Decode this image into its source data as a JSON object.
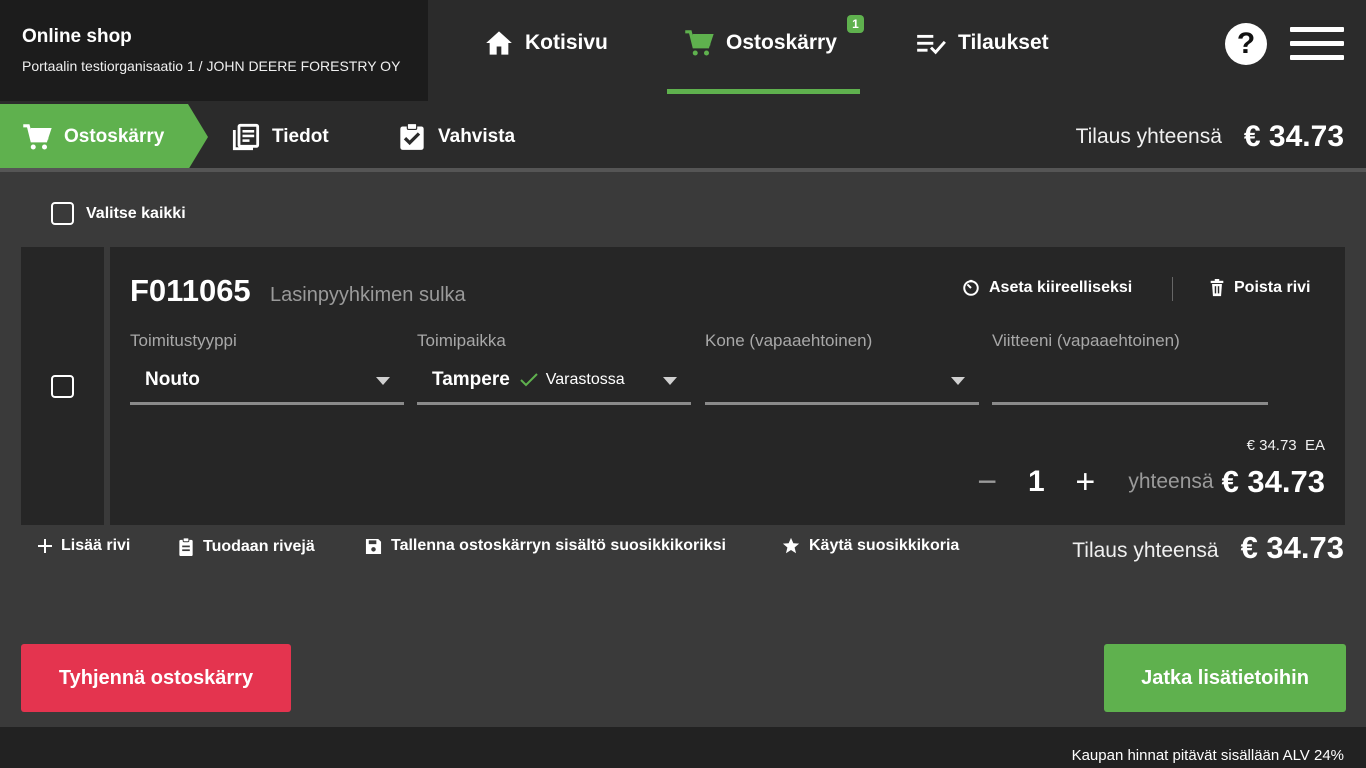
{
  "header": {
    "shop_title": "Online shop",
    "org_name": "Portaalin testiorganisaatio 1 / JOHN DEERE FORESTRY OY",
    "nav": [
      {
        "label": "Kotisivu",
        "icon": "home-icon"
      },
      {
        "label": "Ostoskärry",
        "icon": "cart-icon",
        "badge": "1",
        "active": true
      },
      {
        "label": "Tilaukset",
        "icon": "orders-icon"
      }
    ],
    "help_label": "?"
  },
  "steps": {
    "items": [
      {
        "label": "Ostoskärry",
        "icon": "cart-icon",
        "active": true
      },
      {
        "label": "Tiedot",
        "icon": "document-icon"
      },
      {
        "label": "Vahvista",
        "icon": "clipboard-check-icon"
      }
    ],
    "total_label": "Tilaus yhteensä",
    "total_value": "€ 34.73"
  },
  "select_all_label": "Valitse kaikki",
  "row": {
    "code": "F011065",
    "name": "Lasinpyyhkimen sulka",
    "urgent_label": "Aseta kiireelliseksi",
    "remove_label": "Poista rivi",
    "fields": {
      "delivery": {
        "label": "Toimitustyyppi",
        "value": "Nouto"
      },
      "location": {
        "label": "Toimipaikka",
        "value": "Tampere",
        "stock": "Varastossa"
      },
      "machine": {
        "label": "Kone (vapaaehtoinen)",
        "value": ""
      },
      "reference": {
        "label": "Viitteeni (vapaaehtoinen)",
        "value": ""
      }
    },
    "unit_price": "€ 34.73",
    "unit": "EA",
    "quantity": "1",
    "minus": "−",
    "plus": "+",
    "total_label": "yhteensä",
    "total_value": "€ 34.73"
  },
  "actions": {
    "add_row": "Lisää rivi",
    "import_rows": "Tuodaan rivejä",
    "save_favorite": "Tallenna ostoskärryn sisältö suosikkikoriksi",
    "use_favorite": "Käytä suosikkikoria"
  },
  "summary": {
    "total_label": "Tilaus yhteensä",
    "total_value": "€ 34.73"
  },
  "buttons": {
    "clear": "Tyhjennä ostoskärry",
    "continue": "Jatka lisätietoihin"
  },
  "footer": {
    "vat_note": "Kaupan hinnat pitävät sisällään ALV 24%"
  },
  "colors": {
    "accent": "#5fb14e",
    "danger": "#e4344f",
    "background": "#3a3a3a",
    "panel": "#262626"
  }
}
